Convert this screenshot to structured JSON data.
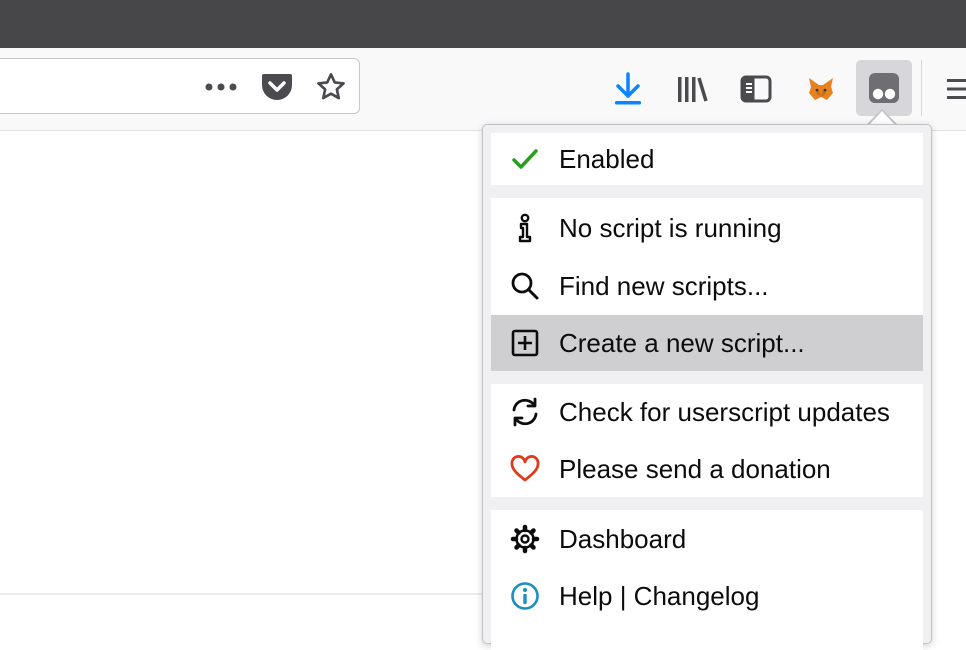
{
  "menu": {
    "groups": [
      {
        "items": [
          {
            "label": "Enabled",
            "icon": "check-icon"
          }
        ]
      },
      {
        "items": [
          {
            "label": "No script is running",
            "icon": "info-i-icon"
          },
          {
            "label": "Find new scripts...",
            "icon": "search-icon"
          },
          {
            "label": "Create a new script...",
            "icon": "plus-box-icon",
            "highlighted": true
          }
        ]
      },
      {
        "items": [
          {
            "label": "Check for userscript updates",
            "icon": "refresh-icon"
          },
          {
            "label": "Please send a donation",
            "icon": "heart-icon"
          }
        ]
      },
      {
        "items": [
          {
            "label": "Dashboard",
            "icon": "gear-icon"
          },
          {
            "label": "Help | Changelog",
            "icon": "info-circle-icon"
          }
        ]
      }
    ]
  },
  "toolbar": {
    "icons": [
      "more-icon",
      "pocket-icon",
      "star-icon",
      "download-icon",
      "library-icon",
      "sidebar-icon",
      "metamask-fox-icon",
      "tampermonkey-icon",
      "hamburger-menu-icon"
    ]
  },
  "colors": {
    "check": "#2a9d1f",
    "heart": "#e0391e",
    "download": "#0a84ff",
    "help": "#1a8fc0"
  }
}
